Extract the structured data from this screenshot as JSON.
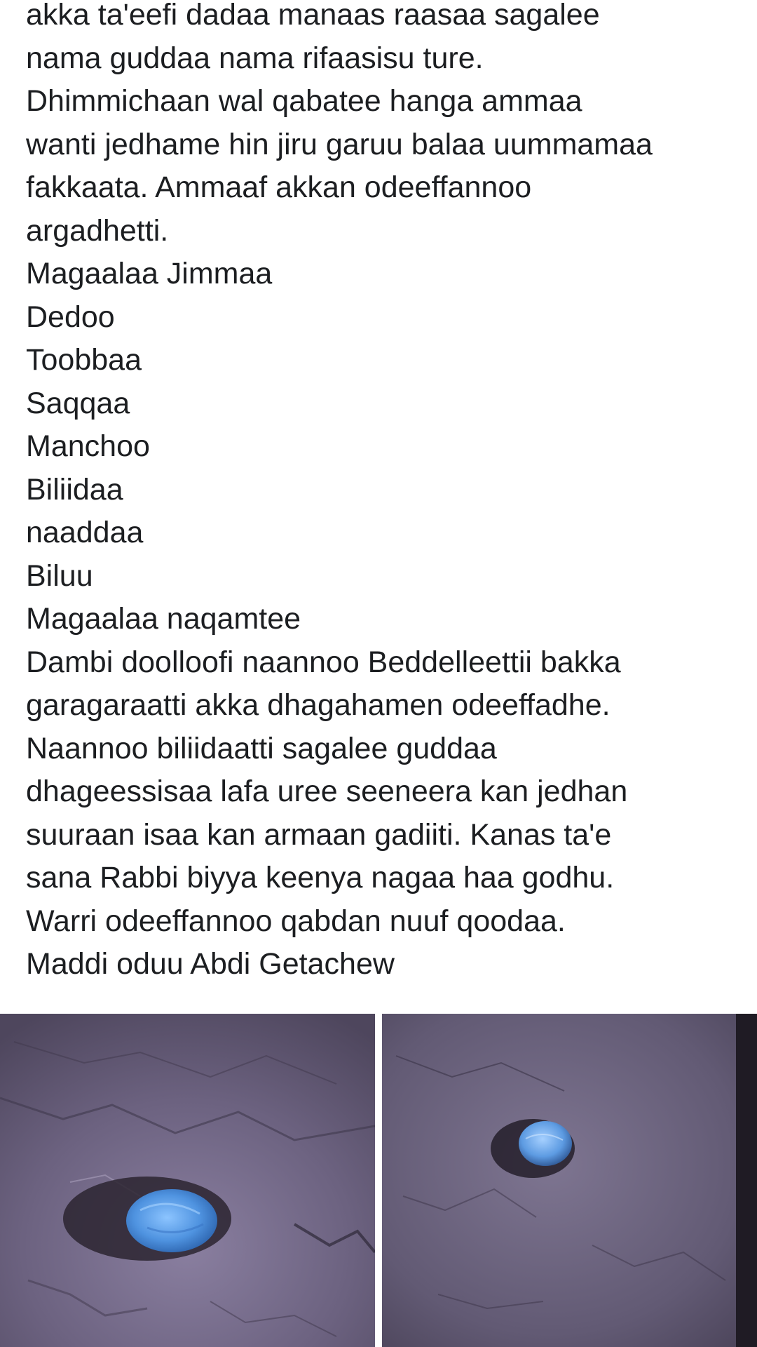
{
  "post": {
    "lines": [
      "akka ta'eefi dadaa manaas raasaa sagalee",
      "nama guddaa nama rifaasisu ture.",
      "Dhimmichaan wal qabatee hanga ammaa",
      "wanti jedhame hin jiru garuu balaa uummamaa",
      "fakkaata. Ammaaf akkan odeeffannoo",
      "argadhetti.",
      "Magaalaa Jimmaa",
      "Dedoo",
      "Toobbaa",
      "Saqqaa",
      "Manchoo",
      "Biliidaa",
      "naaddaa",
      "Biluu",
      "Magaalaa naqamtee",
      "Dambi doolloofi naannoo Beddelleettii bakka",
      "garagaraatti  akka dhagahamen odeeffadhe.",
      "Naannoo biliidaatti sagalee guddaa",
      "dhageessisaa lafa uree seeneera kan jedhan",
      "suuraan isaa kan armaan gadiiti. Kanas ta'e",
      "sana Rabbi biyya keenya nagaa haa godhu.",
      "Warri odeeffannoo qabdan nuuf qoodaa.",
      "Maddi oduu Abdi Getachew"
    ]
  },
  "photos": [
    {
      "id": "left",
      "subject": "blue object in hole in cracked soil"
    },
    {
      "id": "right",
      "subject": "blue object in small hole in soil"
    }
  ],
  "colors": {
    "text": "#1c1e21",
    "background": "#ffffff",
    "soil": "#6f6580",
    "object_blue": "#5b9ee6"
  }
}
